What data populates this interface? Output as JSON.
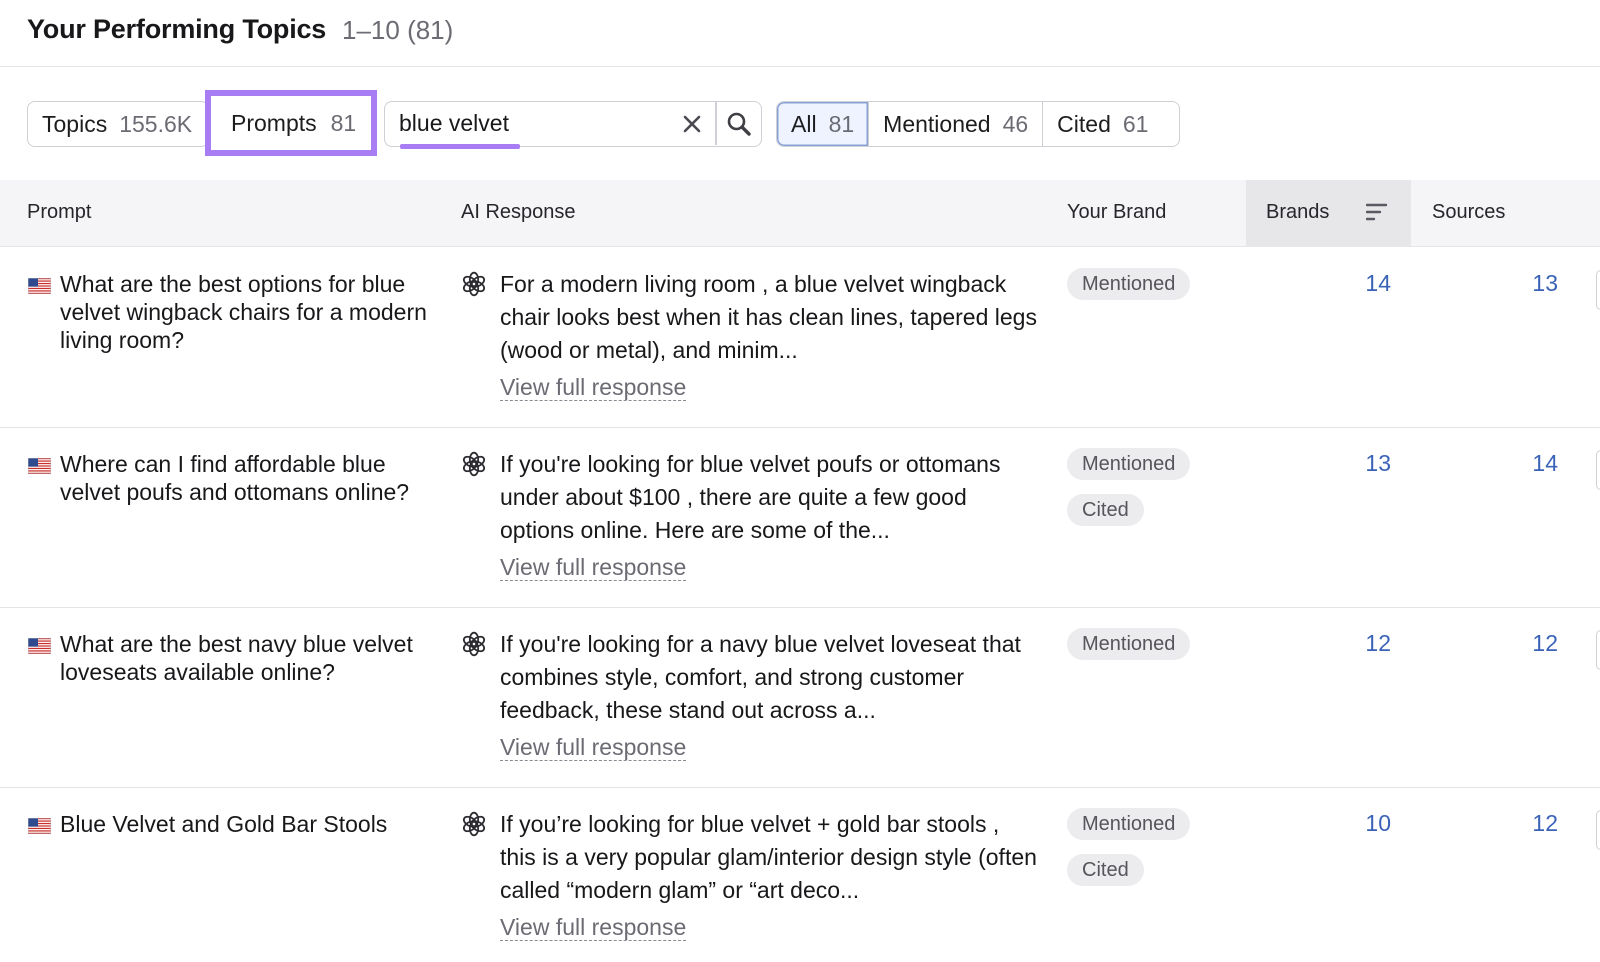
{
  "header": {
    "title": "Your Performing Topics",
    "range": "1–10 (81)"
  },
  "view_toggle": {
    "topics": {
      "label": "Topics",
      "count": "155.6K"
    },
    "prompts": {
      "label": "Prompts",
      "count": "81"
    }
  },
  "search": {
    "value": "blue velvet",
    "clear_icon": "close-icon",
    "search_icon": "search-icon"
  },
  "filters": [
    {
      "label": "All",
      "count": "81",
      "active": true
    },
    {
      "label": "Mentioned",
      "count": "46"
    },
    {
      "label": "Cited",
      "count": "61"
    }
  ],
  "table": {
    "headers": {
      "prompt": "Prompt",
      "ai_response": "AI Response",
      "your_brand": "Your Brand",
      "brands": "Brands",
      "sources": "Sources"
    },
    "rows": [
      {
        "prompt": "What are the best options for blue velvet wingback chairs for a modern living room?",
        "response": "For a modern living room , a blue velvet wingback chair looks best when it has clean lines, tapered legs (wood or metal), and minim...",
        "link": "View full response",
        "badges": [
          "Mentioned"
        ],
        "brands": "14",
        "sources": "13"
      },
      {
        "prompt": "Where can I find affordable blue velvet poufs and ottomans online?",
        "response": "If you're looking for blue velvet poufs or ottomans under about $100 , there are quite a few good options online. Here are some of the...",
        "link": "View full response",
        "badges": [
          "Mentioned",
          "Cited"
        ],
        "brands": "13",
        "sources": "14"
      },
      {
        "prompt": "What are the best navy blue velvet loveseats available online?",
        "response": "If you're looking for a navy blue velvet loveseat that combines style, comfort, and strong customer feedback, these stand out across a...",
        "link": "View full response",
        "badges": [
          "Mentioned"
        ],
        "brands": "12",
        "sources": "12"
      },
      {
        "prompt": "Blue Velvet and Gold Bar Stools",
        "response": "If you’re looking for blue velvet + gold bar stools , this is a very popular glam/interior design style (often called “modern glam” or “art deco...",
        "link": "View full response",
        "badges": [
          "Mentioned",
          "Cited"
        ],
        "brands": "10",
        "sources": "12"
      }
    ]
  },
  "colors": {
    "highlight": "#a87cf2",
    "link_number": "#3a63b8",
    "active_filter_bg": "#eef3ff"
  }
}
